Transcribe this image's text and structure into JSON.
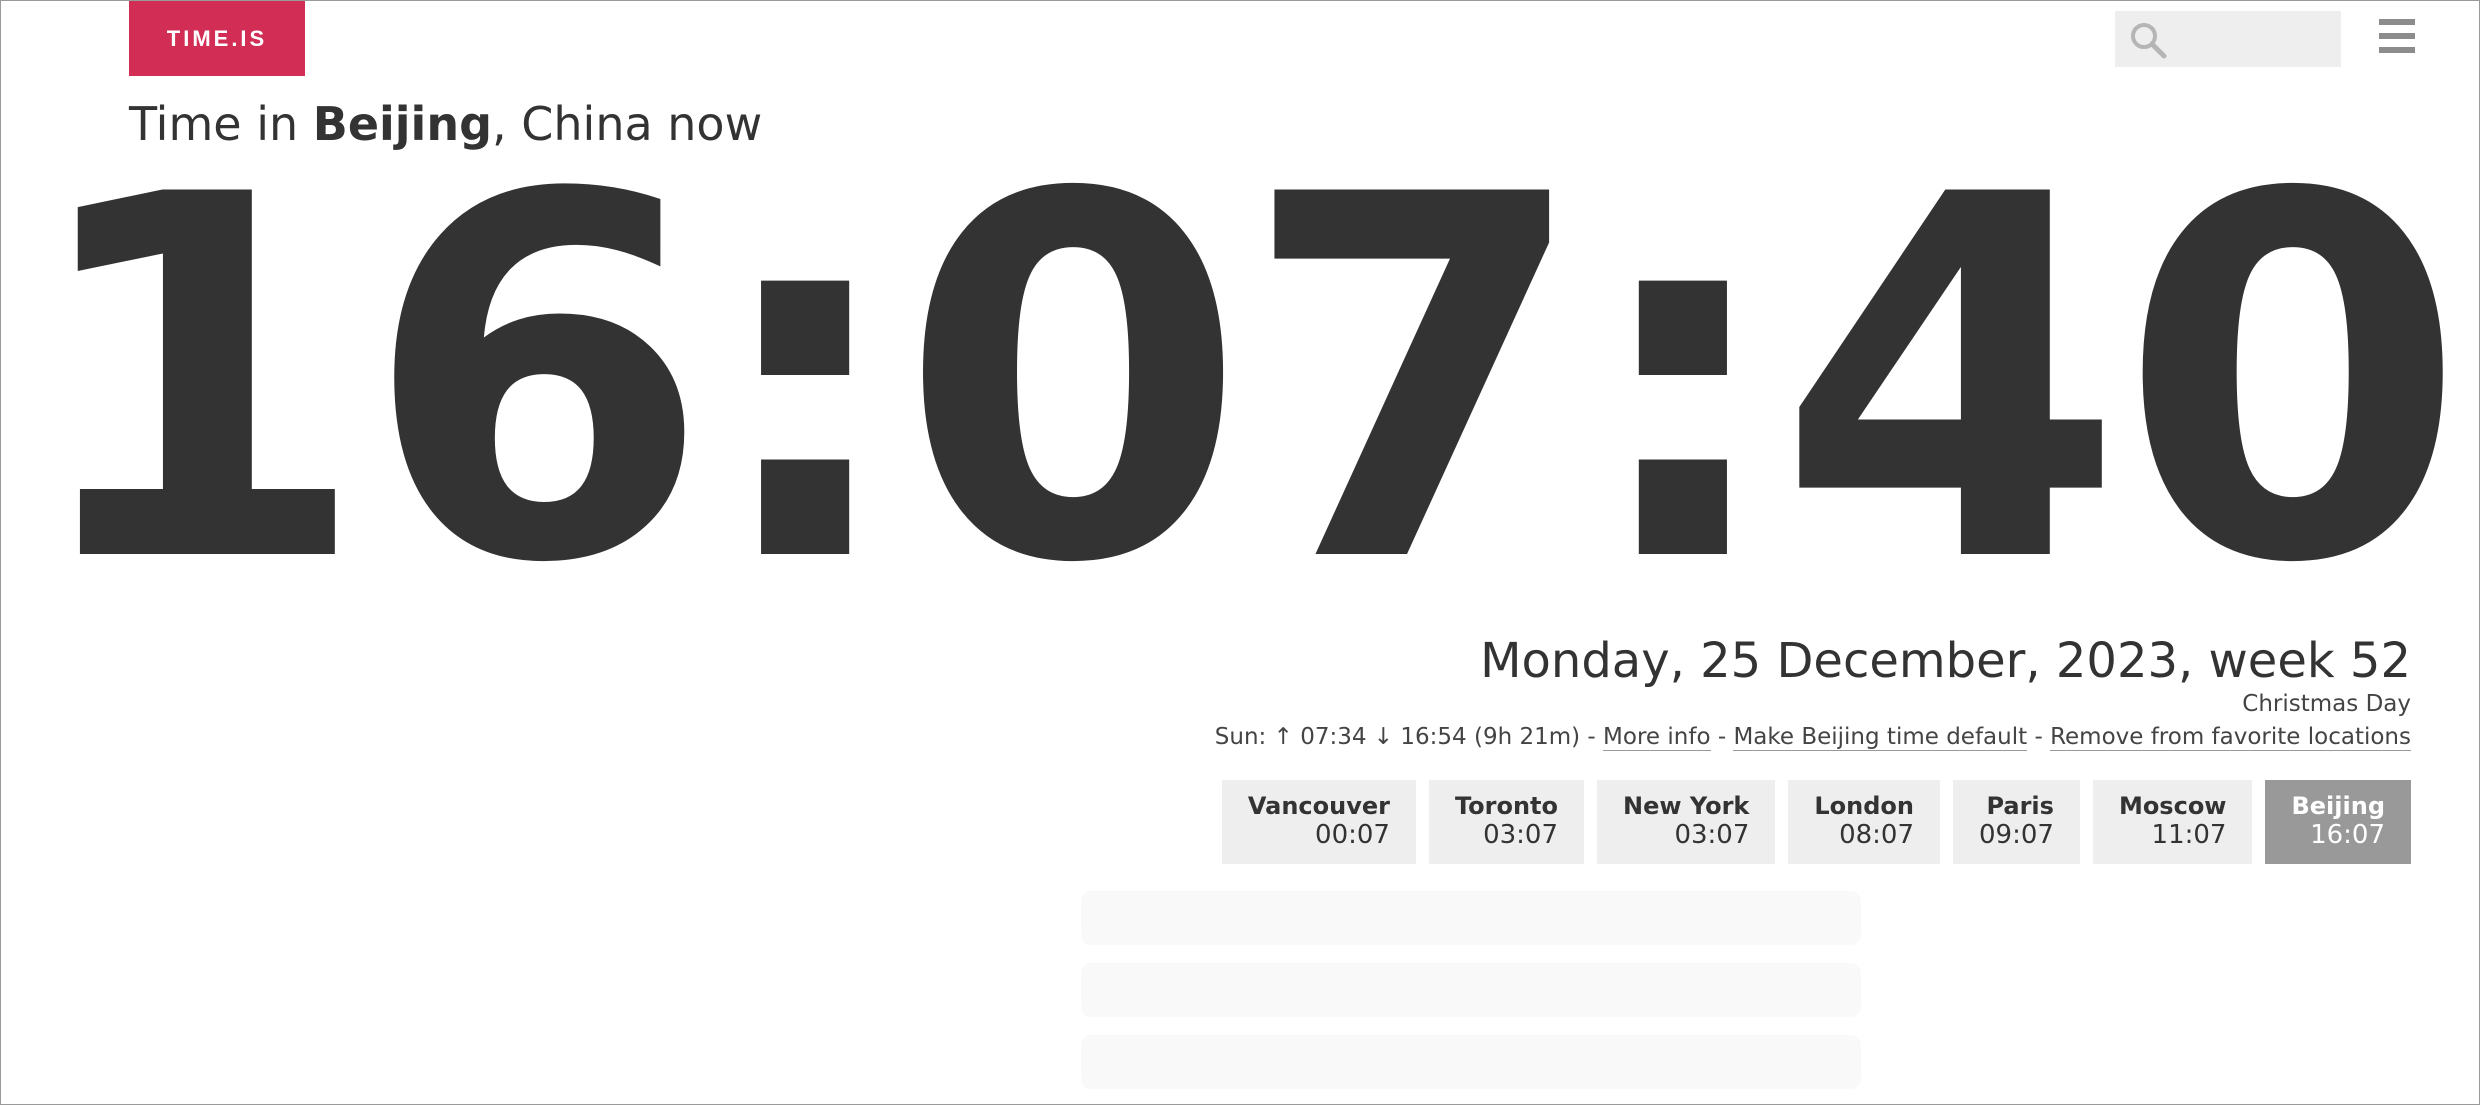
{
  "logo": {
    "label": "TIME.IS"
  },
  "search": {
    "value": "",
    "placeholder": ""
  },
  "heading": {
    "prefix": "Time in ",
    "city": "Beijing",
    "suffix": ", China now"
  },
  "clock": {
    "time": "16:07:40"
  },
  "date": {
    "text": "Monday, 25 December, 2023, week 52"
  },
  "holiday": {
    "text": "Christmas Day"
  },
  "sun": {
    "prefix": "Sun: ",
    "sunrise_arrow": "↑",
    "sunrise": " 07:34 ",
    "sunset_arrow": "↓",
    "sunset": " 16:54 (9h 21m) - ",
    "more_info": "More info",
    "sep1": " - ",
    "make_default": "Make Beijing time default",
    "sep2": " - ",
    "remove_favorite": "Remove from favorite locations"
  },
  "cities": [
    {
      "name": "Vancouver",
      "time": "00:07"
    },
    {
      "name": "Toronto",
      "time": "03:07"
    },
    {
      "name": "New York",
      "time": "03:07"
    },
    {
      "name": "London",
      "time": "08:07"
    },
    {
      "name": "Paris",
      "time": "09:07"
    },
    {
      "name": "Moscow",
      "time": "11:07"
    },
    {
      "name": "Beijing",
      "time": "16:07",
      "active": true
    }
  ],
  "colors": {
    "brand": "#d22d54",
    "text": "#333333",
    "city_bg": "#eeeeee",
    "city_active_bg": "#999999"
  },
  "icons": {
    "search": "search-icon",
    "menu": "hamburger-menu-icon"
  }
}
